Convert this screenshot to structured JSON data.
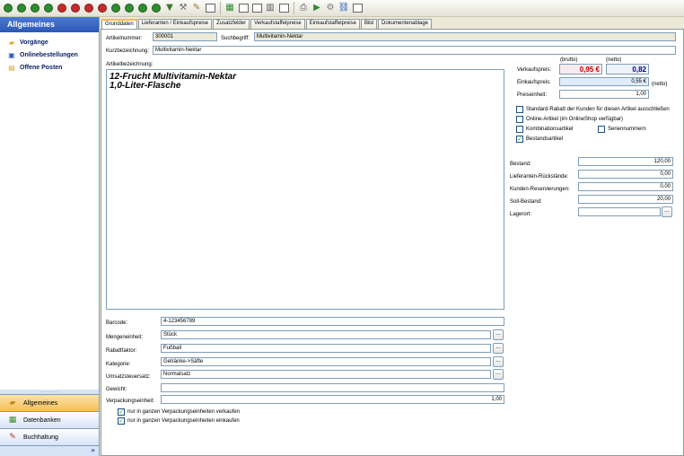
{
  "toolbar": {
    "buttons": [
      {
        "icon": "circle-icon",
        "color": "#2f8d2f",
        "glyph": "◉"
      },
      {
        "icon": "circle-icon",
        "color": "#2f8d2f",
        "glyph": "◉"
      },
      {
        "icon": "circle-icon",
        "color": "#2f8d2f",
        "glyph": "◉"
      },
      {
        "icon": "circle-icon",
        "color": "#2f8d2f",
        "glyph": "◉"
      },
      {
        "icon": "circle-icon",
        "color": "#c62b2b",
        "glyph": "◉"
      },
      {
        "icon": "circle-icon",
        "color": "#c62b2b",
        "glyph": "◉"
      },
      {
        "icon": "circle-icon",
        "color": "#c62b2b",
        "glyph": "◉"
      },
      {
        "icon": "circle-icon",
        "color": "#c62b2b",
        "glyph": "◉"
      },
      {
        "icon": "circle-icon",
        "color": "#2f8d2f",
        "glyph": "◉"
      },
      {
        "icon": "circle-icon",
        "color": "#2f8d2f",
        "glyph": "◉"
      },
      {
        "icon": "circle-icon",
        "color": "#2f8d2f",
        "glyph": "◉"
      },
      {
        "icon": "circle-icon",
        "color": "#2f8d2f",
        "glyph": "◉"
      }
    ]
  },
  "sidebar": {
    "title": "Allgemeines",
    "items": [
      {
        "label": "Vorgänge",
        "icon": "folder-icon"
      },
      {
        "label": "Onlinebestellungen",
        "icon": "window-icon"
      },
      {
        "label": "Offene Posten",
        "icon": "list-icon"
      }
    ],
    "nav": [
      {
        "label": "Allgemeines",
        "icon": "folder-icon",
        "active": true
      },
      {
        "label": "Datenbanken",
        "icon": "database-icon",
        "active": false
      },
      {
        "label": "Buchhaltung",
        "icon": "ledger-icon",
        "active": false
      }
    ],
    "footer_glyph": "»"
  },
  "tabs": [
    "Grunddaten",
    "Lieferanten / Einkaufspreise",
    "Zusatzfelder",
    "Verkaufstaffelpreise",
    "Einkaufstaffelpreise",
    "Bild",
    "Dokumentenablage"
  ],
  "form": {
    "artikelnummer_label": "Artikelnummer:",
    "artikelnummer": "300001",
    "suchbegriff_label": "Suchbegriff:",
    "suchbegriff": "Multivitamin-Nektar",
    "kurzbezeichnung_label": "Kurzbezeichnung:",
    "kurzbezeichnung": "Multivitamin-Nektar",
    "artikelbezeichnung_label": "Artikelbezeichnung:",
    "artikelbezeichnung_line1": "12-Frucht Multivitamin-Nektar",
    "artikelbezeichnung_line2": "1,0-Liter-Flasche",
    "barcode_label": "Barcode:",
    "barcode": "4-123456789",
    "mengeneinheit_label": "Mengeneinheit:",
    "mengeneinheit": "Stück",
    "rabattfaktor_label": "Rabattfaktor:",
    "rabattfaktor": "Fußball",
    "kategorie_label": "Kategorie:",
    "kategorie": "Getränke->Säfte",
    "umsatzsteuersatz_label": "Umsatzsteuersatz:",
    "umsatzsteuersatz": "Normalsatz",
    "gewicht_label": "Gewicht:",
    "gewicht": "",
    "verpackungseinheit_label": "Verpackungseinheit:",
    "verpackungseinheit": "1,00",
    "chk_verkaufen": "nur in ganzen Verpackungseinheiten verkaufen",
    "chk_einkaufen": "nur in ganzen Verpackungseinheiten einkaufen"
  },
  "prices": {
    "brutto_label": "(brutto)",
    "netto_label": "(netto)",
    "verkaufspreis_label": "Verkaufspreis:",
    "verkaufspreis_brutto": "0,95 €",
    "verkaufspreis_netto": "0,82",
    "einkaufspreis_label": "Einkaufspreis:",
    "einkaufspreis": "0,55 €",
    "einkaufspreis_suffix": "(netto)",
    "preiseinheit_label": "Preiseinheit:",
    "preiseinheit": "1,00",
    "brutto_color": "#c00000",
    "netto_color": "#00008b"
  },
  "options": {
    "standard_rabatt": "Standard-Rabatt der Kunden für diesen Artikel ausschließen",
    "online_artikel": "Online-Artikel (im OnlineShop verfügbar)",
    "kombinationsartikel": "Kombinationsartikel",
    "seriennummern": "Seriennummern",
    "bestandsartikel": "Bestandsartikel"
  },
  "stock": {
    "bestand_label": "Bestand:",
    "bestand": "120,00",
    "lieferanten_label": "Lieferanten-Rückstände:",
    "lieferanten": "0,00",
    "kunden_label": "Kunden-Reservierungen:",
    "kunden": "0,00",
    "soll_label": "Soll-Bestand:",
    "soll": "20,00",
    "lagerort_label": "Lagerort:",
    "lagerort": ""
  },
  "button_glyph": "..."
}
